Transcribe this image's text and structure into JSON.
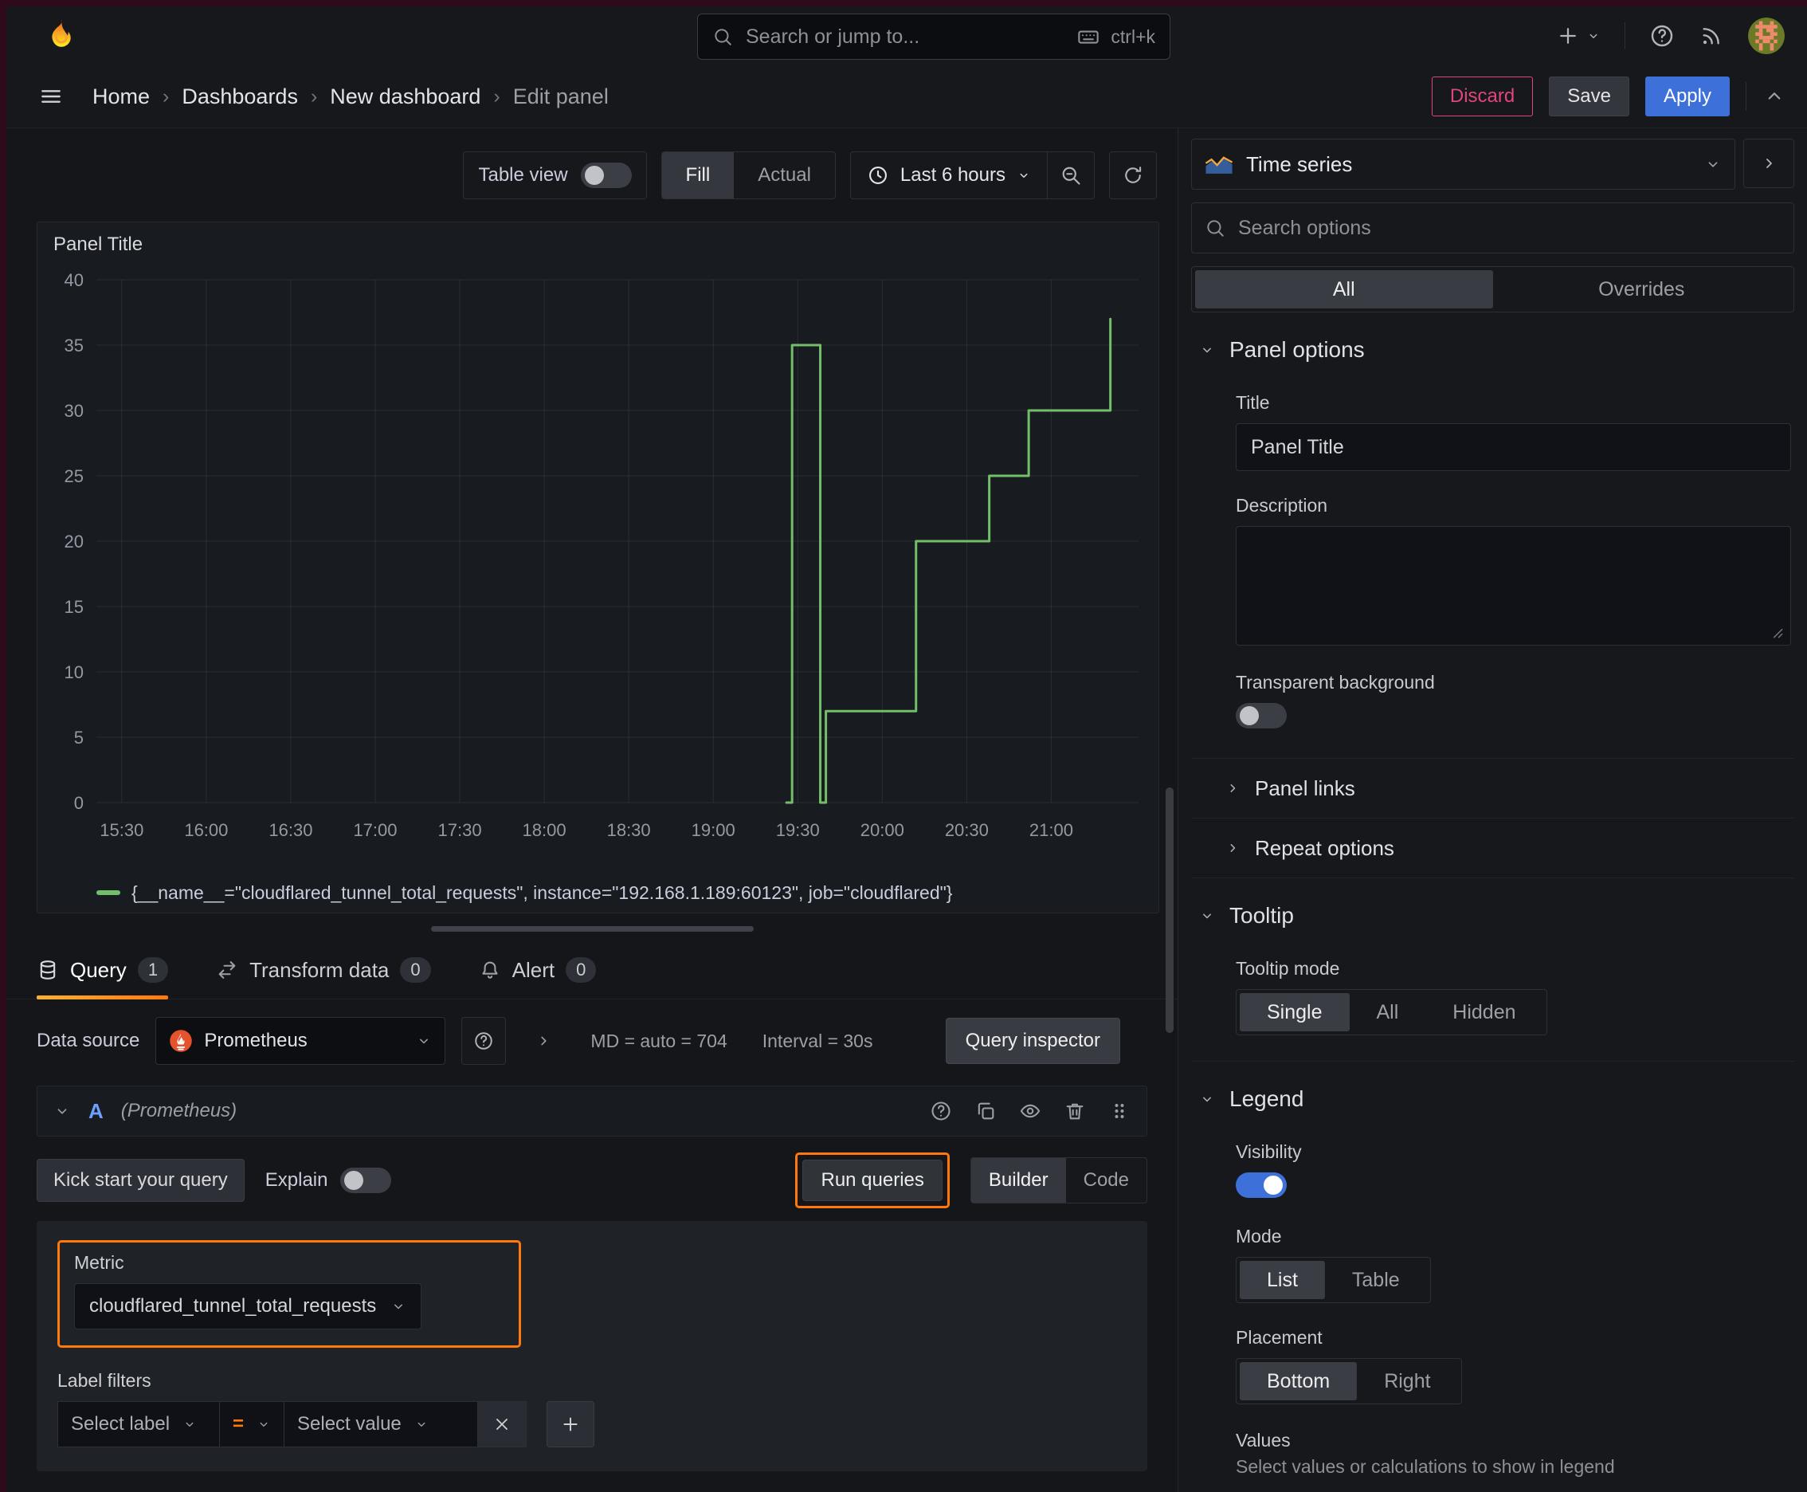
{
  "topbar": {
    "search_placeholder": "Search or jump to...",
    "shortcut": "ctrl+k"
  },
  "breadcrumb": {
    "separator": "›",
    "items": [
      "Home",
      "Dashboards",
      "New dashboard",
      "Edit panel"
    ]
  },
  "actions": {
    "discard": "Discard",
    "save": "Save",
    "apply": "Apply"
  },
  "toolbar": {
    "table_view": "Table view",
    "fill": "Fill",
    "actual": "Actual",
    "time_range": "Last 6 hours"
  },
  "panel": {
    "title": "Panel Title"
  },
  "chart_data": {
    "type": "line",
    "line_style": "step-after",
    "title": "Panel Title",
    "xlabel": "",
    "ylabel": "",
    "grid": true,
    "legend_position": "bottom",
    "ylim": [
      0,
      40
    ],
    "y_ticks": [
      0,
      5,
      10,
      15,
      20,
      25,
      30,
      35,
      40
    ],
    "x_ticks": [
      "15:30",
      "16:00",
      "16:30",
      "17:00",
      "17:30",
      "18:00",
      "18:30",
      "19:00",
      "19:30",
      "20:00",
      "20:30",
      "21:00"
    ],
    "x_range": [
      "15:21",
      "21:31"
    ],
    "series": [
      {
        "name": "{__name__=\"cloudflared_tunnel_total_requests\", instance=\"192.168.1.189:60123\", job=\"cloudflared\"}",
        "color": "#73bf69",
        "points": [
          [
            "19:26",
            0
          ],
          [
            "19:28",
            35
          ],
          [
            "19:38",
            0
          ],
          [
            "19:40",
            7
          ],
          [
            "20:12",
            20
          ],
          [
            "20:38",
            25
          ],
          [
            "20:52",
            30
          ],
          [
            "21:21",
            37
          ]
        ]
      }
    ]
  },
  "tabs": {
    "query": "Query",
    "query_count": "1",
    "transform": "Transform data",
    "transform_count": "0",
    "alert": "Alert",
    "alert_count": "0"
  },
  "datasource_row": {
    "label": "Data source",
    "value": "Prometheus",
    "stats": "MD = auto = 704",
    "interval": "Interval = 30s",
    "inspector": "Query inspector"
  },
  "query_row": {
    "ref": "A",
    "datasource": "(Prometheus)"
  },
  "query_editor": {
    "kick_start": "Kick start your query",
    "explain": "Explain",
    "run": "Run queries",
    "builder": "Builder",
    "code": "Code",
    "metric_label": "Metric",
    "metric_value": "cloudflared_tunnel_total_requests",
    "label_filters": "Label filters",
    "select_label": "Select label",
    "op": "=",
    "select_value": "Select value"
  },
  "options": {
    "viz": "Time series",
    "search_placeholder": "Search options",
    "tabs": {
      "all": "All",
      "overrides": "Overrides"
    },
    "panel_options": {
      "title": "Panel options",
      "title_label": "Title",
      "title_value": "Panel Title",
      "desc_label": "Description",
      "transparent": "Transparent background"
    },
    "links": "Panel links",
    "repeat": "Repeat options",
    "tooltip": {
      "title": "Tooltip",
      "mode_label": "Tooltip mode",
      "single": "Single",
      "all": "All",
      "hidden": "Hidden"
    },
    "legend": {
      "title": "Legend",
      "visibility": "Visibility",
      "mode_label": "Mode",
      "list": "List",
      "table": "Table",
      "placement_label": "Placement",
      "bottom": "Bottom",
      "right": "Right",
      "values_label": "Values",
      "values_help": "Select values or calculations to show in legend"
    }
  },
  "colors": {
    "accent_orange": "#ff780a",
    "accent_blue": "#3d71d9",
    "series_green": "#73bf69",
    "destructive_pink": "#e0457b"
  }
}
